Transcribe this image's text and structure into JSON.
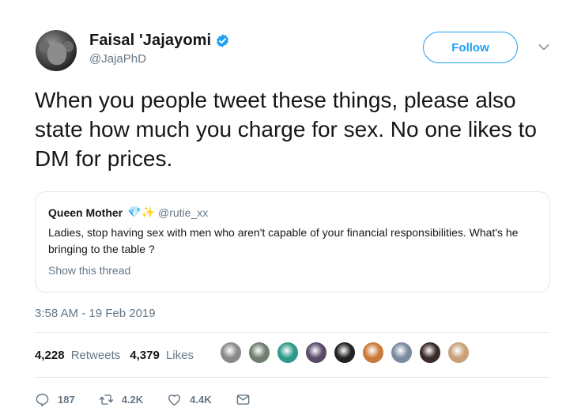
{
  "author": {
    "name": "Faisal 'Jajayomi",
    "handle": "@JajaPhD",
    "avatar_icon": "monkey-avatar"
  },
  "follow_label": "Follow",
  "tweet_text": "When you people tweet these things, please also state how much you charge for sex. No one likes to DM for prices.",
  "quote": {
    "name": "Queen Mother",
    "emoji": "💎✨",
    "handle": "@rutie_xx",
    "text": "Ladies, stop having sex with men who aren't capable of your financial responsibilities. What's he bringing to the table ?",
    "show_thread": "Show this thread"
  },
  "timestamp": "3:58 AM - 19 Feb 2019",
  "stats": {
    "retweets_count": "4,228",
    "retweets_label": "Retweets",
    "likes_count": "4,379",
    "likes_label": "Likes"
  },
  "liker_avatars": [
    "#8a8a8a",
    "#6f7f6f",
    "#2f9a8a",
    "#5a4a6a",
    "#222222",
    "#c87a3a",
    "#7a8aa0",
    "#3a2a2a",
    "#c8a07a"
  ],
  "actions": {
    "replies": "187",
    "retweets": "4.2K",
    "likes": "4.4K"
  },
  "colors": {
    "accent": "#1da1f2",
    "muted": "#657786",
    "text": "#14171a"
  }
}
